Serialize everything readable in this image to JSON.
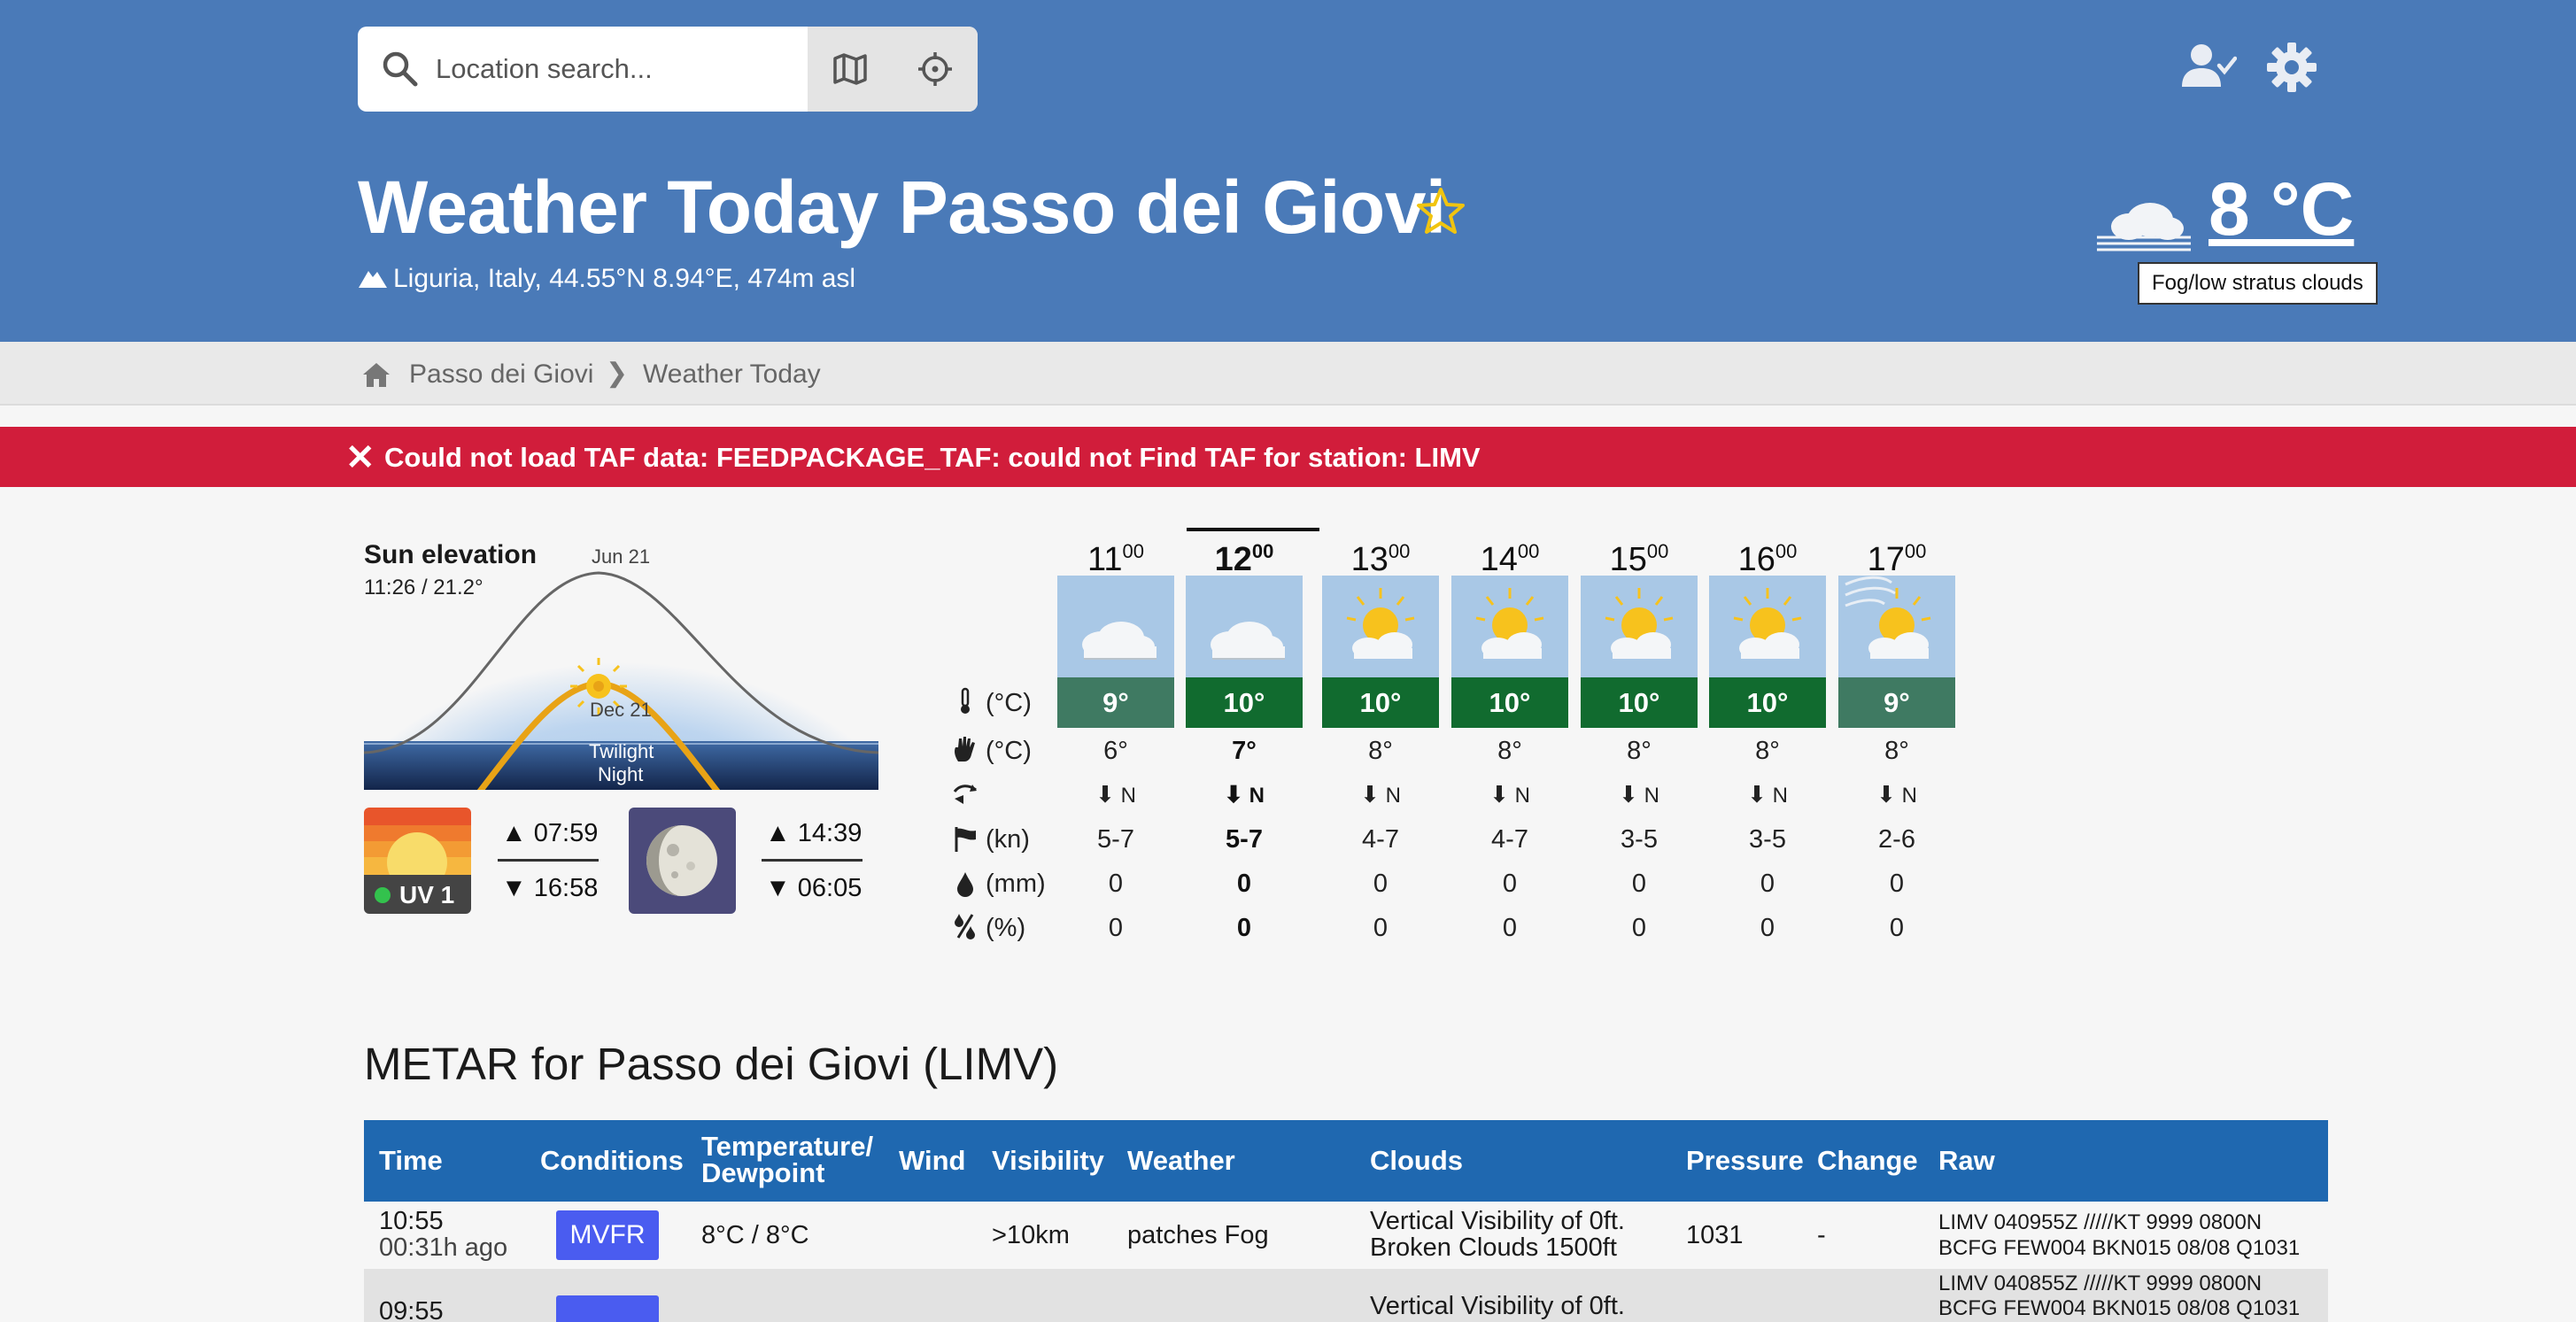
{
  "search": {
    "placeholder": "Location search..."
  },
  "header": {
    "title": "Weather Today Passo dei Giovi",
    "location": "Liguria, Italy, 44.55°N 8.94°E, 474m asl",
    "current_temp": "8 °C",
    "current_condition_tooltip": "Fog/low stratus clouds"
  },
  "breadcrumb": {
    "items": [
      "Passo dei Giovi",
      "Weather Today"
    ],
    "separator": "❯"
  },
  "error": {
    "icon": "close-icon",
    "message": "Could not load TAF data: FEEDPACKAGE_TAF: could not Find TAF for station: LIMV"
  },
  "sun": {
    "title": "Sun elevation",
    "current": "11:26 / 21.2°",
    "label_summer": "Jun 21",
    "label_winter": "Dec 21",
    "label_twilight": "Twilight",
    "label_night": "Night",
    "uv": "UV 1",
    "sunrise": "07:59",
    "sunset": "16:58",
    "moonrise": "14:39",
    "moonset": "06:05"
  },
  "forecast": {
    "hours": [
      {
        "h": "11",
        "m": "00",
        "temp": "9°",
        "felt": "6°",
        "wind_dir": "N",
        "wind": "5-7",
        "precip": "0",
        "prob": "0",
        "sky": "cloudy",
        "band": "grey"
      },
      {
        "h": "12",
        "m": "00",
        "temp": "10°",
        "felt": "7°",
        "wind_dir": "N",
        "wind": "5-7",
        "precip": "0",
        "prob": "0",
        "sky": "cloudy",
        "band": "green"
      },
      {
        "h": "13",
        "m": "00",
        "temp": "10°",
        "felt": "8°",
        "wind_dir": "N",
        "wind": "4-7",
        "precip": "0",
        "prob": "0",
        "sky": "sunny-cloud",
        "band": "green"
      },
      {
        "h": "14",
        "m": "00",
        "temp": "10°",
        "felt": "8°",
        "wind_dir": "N",
        "wind": "4-7",
        "precip": "0",
        "prob": "0",
        "sky": "sunny-cloud",
        "band": "green"
      },
      {
        "h": "15",
        "m": "00",
        "temp": "10°",
        "felt": "8°",
        "wind_dir": "N",
        "wind": "3-5",
        "precip": "0",
        "prob": "0",
        "sky": "sunny-cloud",
        "band": "green"
      },
      {
        "h": "16",
        "m": "00",
        "temp": "10°",
        "felt": "8°",
        "wind_dir": "N",
        "wind": "3-5",
        "precip": "0",
        "prob": "0",
        "sky": "sunny-cloud",
        "band": "green"
      },
      {
        "h": "17",
        "m": "00",
        "temp": "9°",
        "felt": "8°",
        "wind_dir": "N",
        "wind": "2-6",
        "precip": "0",
        "prob": "0",
        "sky": "sunny-fog",
        "band": "grey"
      }
    ],
    "row_labels": {
      "temp": "(°C)",
      "felt": "(°C)",
      "wind": "(kn)",
      "precip": "(mm)",
      "prob": "(%)"
    }
  },
  "metar": {
    "title": "METAR for Passo dei Giovi (LIMV)",
    "columns": [
      "Time",
      "Conditions",
      "Temperature/\nDewpoint",
      "Wind",
      "Visibility",
      "Weather",
      "Clouds",
      "Pressure",
      "Change",
      "Raw"
    ],
    "rows": [
      {
        "time": "10:55",
        "ago": "00:31h ago",
        "category": "MVFR",
        "temp": "8°C / 8°C",
        "wind": "",
        "visibility": ">10km",
        "weather": "patches Fog",
        "clouds_1": "Vertical Visibility of 0ft.",
        "clouds_2": "Broken Clouds 1500ft",
        "pressure": "1031",
        "change": "-",
        "raw_1": "LIMV 040955Z /////KT 9999 0800N",
        "raw_2": "BCFG FEW004 BKN015 08/08 Q1031"
      },
      {
        "time": "09:55",
        "ago": "",
        "category": "",
        "temp": "",
        "wind": "",
        "visibility": "",
        "weather": "",
        "clouds_1": "Vertical Visibility of 0ft.",
        "clouds_2": "",
        "pressure": "",
        "change": "",
        "raw_1": "LIMV 040855Z /////KT 9999 0800N",
        "raw_2": "BCFG FEW004 BKN015 08/08 Q1031"
      }
    ]
  },
  "colors": {
    "header_bg": "#4a7ab8",
    "error_bg": "#d11d3b",
    "table_head": "#1f68b0",
    "mvfr": "#4a5cf0",
    "temp_band_green": "#116b2f",
    "temp_band_grey": "#3f7a62"
  }
}
